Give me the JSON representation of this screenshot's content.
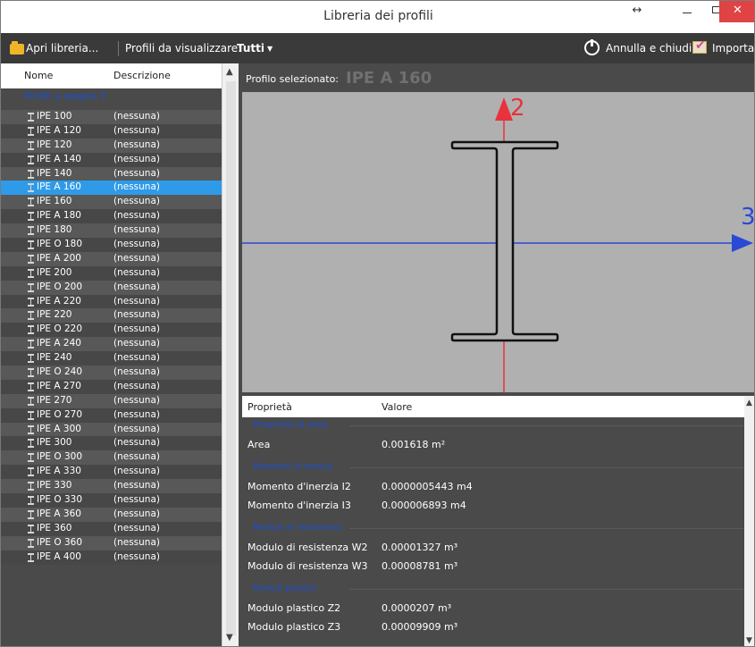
{
  "window": {
    "title": "Libreria dei profili",
    "controls": {
      "resize": "↔",
      "close": "✕"
    }
  },
  "toolbar": {
    "open_label": "Apri libreria...",
    "profiles_label": "Profili da visualizzare:",
    "profiles_value": "Tutti",
    "cancel_label": "Annulla e chiudi",
    "import_label": "Importa"
  },
  "list": {
    "col_name": "Nome",
    "col_desc": "Descrizione",
    "group": "Profili a doppio T",
    "rows": [
      {
        "name": "IPE 100",
        "desc": "(nessuna)"
      },
      {
        "name": "IPE A 120",
        "desc": "(nessuna)"
      },
      {
        "name": "IPE 120",
        "desc": "(nessuna)"
      },
      {
        "name": "IPE A 140",
        "desc": "(nessuna)"
      },
      {
        "name": "IPE 140",
        "desc": "(nessuna)"
      },
      {
        "name": "IPE A 160",
        "desc": "(nessuna)",
        "selected": true
      },
      {
        "name": "IPE 160",
        "desc": "(nessuna)"
      },
      {
        "name": "IPE A 180",
        "desc": "(nessuna)"
      },
      {
        "name": "IPE 180",
        "desc": "(nessuna)"
      },
      {
        "name": "IPE O 180",
        "desc": "(nessuna)"
      },
      {
        "name": "IPE A 200",
        "desc": "(nessuna)"
      },
      {
        "name": "IPE 200",
        "desc": "(nessuna)"
      },
      {
        "name": "IPE O 200",
        "desc": "(nessuna)"
      },
      {
        "name": "IPE A 220",
        "desc": "(nessuna)"
      },
      {
        "name": "IPE 220",
        "desc": "(nessuna)"
      },
      {
        "name": "IPE O 220",
        "desc": "(nessuna)"
      },
      {
        "name": "IPE A 240",
        "desc": "(nessuna)"
      },
      {
        "name": "IPE 240",
        "desc": "(nessuna)"
      },
      {
        "name": "IPE O 240",
        "desc": "(nessuna)"
      },
      {
        "name": "IPE A 270",
        "desc": "(nessuna)"
      },
      {
        "name": "IPE 270",
        "desc": "(nessuna)"
      },
      {
        "name": "IPE O 270",
        "desc": "(nessuna)"
      },
      {
        "name": "IPE A 300",
        "desc": "(nessuna)"
      },
      {
        "name": "IPE 300",
        "desc": "(nessuna)"
      },
      {
        "name": "IPE O 300",
        "desc": "(nessuna)"
      },
      {
        "name": "IPE A 330",
        "desc": "(nessuna)"
      },
      {
        "name": "IPE 330",
        "desc": "(nessuna)"
      },
      {
        "name": "IPE O 330",
        "desc": "(nessuna)"
      },
      {
        "name": "IPE A 360",
        "desc": "(nessuna)"
      },
      {
        "name": "IPE 360",
        "desc": "(nessuna)"
      },
      {
        "name": "IPE O 360",
        "desc": "(nessuna)"
      },
      {
        "name": "IPE A 400",
        "desc": "(nessuna)"
      }
    ]
  },
  "selection": {
    "label": "Profilo selezionato:",
    "value": "IPE A 160"
  },
  "drawing": {
    "axis_vertical_label": "2",
    "axis_horizontal_label": "3"
  },
  "properties": {
    "col_prop": "Proprietà",
    "col_val": "Valore",
    "sections": [
      {
        "title": "Proprietà di area",
        "items": [
          {
            "name": "Area",
            "value": "0.001618 m²"
          }
        ]
      },
      {
        "title": "Momenti d'inerzia",
        "items": [
          {
            "name": "Momento d'inerzia I2",
            "value": "0.0000005443 m4"
          },
          {
            "name": "Momento d'inerzia I3",
            "value": "0.000006893 m4"
          }
        ]
      },
      {
        "title": "Moduli di resistenza",
        "items": [
          {
            "name": "Modulo di resistenza W2",
            "value": "0.00001327 m³"
          },
          {
            "name": "Modulo di resistenza W3",
            "value": "0.00008781 m³"
          }
        ]
      },
      {
        "title": "Moduli plastici",
        "items": [
          {
            "name": "Modulo plastico Z2",
            "value": "0.0000207 m³"
          },
          {
            "name": "Modulo plastico Z3",
            "value": "0.00009909 m³"
          }
        ]
      }
    ]
  },
  "colors": {
    "selected_row": "#2f9be8",
    "axis_red": "#e8323c",
    "axis_blue": "#2a49d6",
    "section_label": "#1a4fcf"
  }
}
